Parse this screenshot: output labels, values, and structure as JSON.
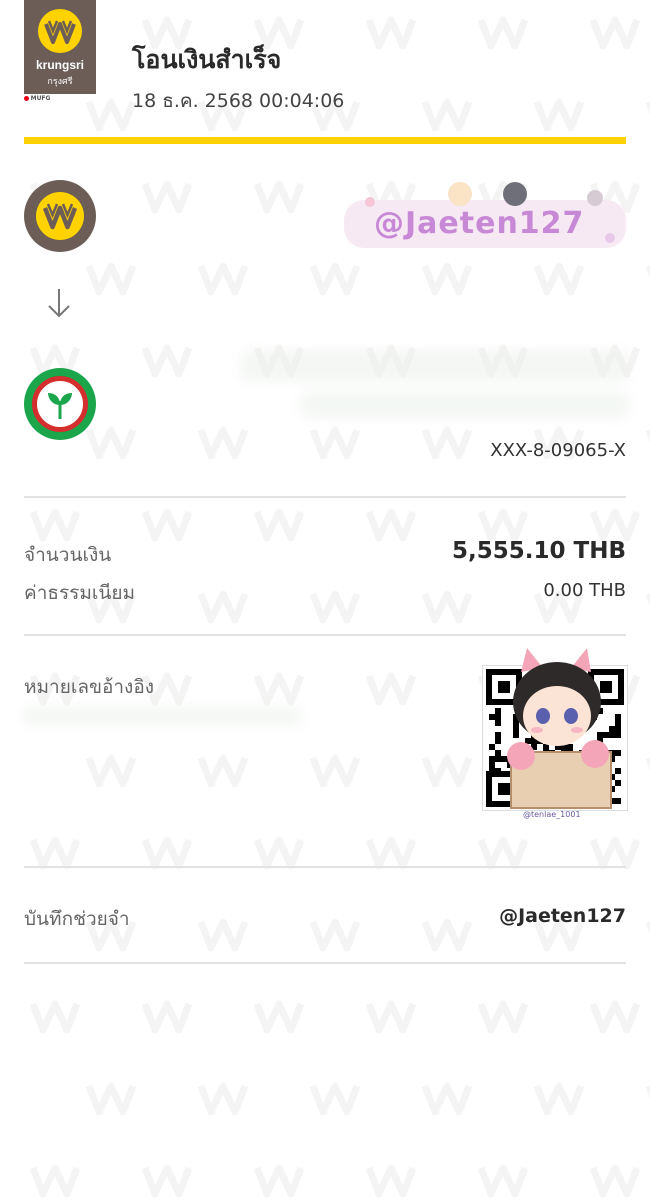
{
  "header": {
    "title": "โอนเงินสำเร็จ",
    "datetime": "18 ธ.ค. 2568 00:04:06",
    "logo_brand": "krungsri",
    "logo_brand_th": "กรุงศรี",
    "logo_tag": "MUFG"
  },
  "colors": {
    "accent_yellow": "#ffd200",
    "krungsri_brown": "#6c5e57",
    "kbank_green": "#1ba64c",
    "kbank_red": "#d32f2f"
  },
  "sender": {
    "bank_icon": "krungsri-logo-icon",
    "sticker_text": "@Jaeten127"
  },
  "receiver": {
    "bank_icon": "kbank-logo-icon",
    "account_number": "XXX-8-09065-X"
  },
  "details": {
    "amount_label": "จำนวนเงิน",
    "amount_value": "5,555.10 THB",
    "fee_label": "ค่าธรรมเนียม",
    "fee_value": "0.00 THB",
    "reference_label": "หมายเลขอ้างอิง",
    "memo_label": "บันทึกช่วยจำ",
    "memo_value": "@Jaeten127"
  },
  "qr": {
    "icon": "qr-code-icon",
    "sticker_tag": "@tenlae_1001"
  }
}
